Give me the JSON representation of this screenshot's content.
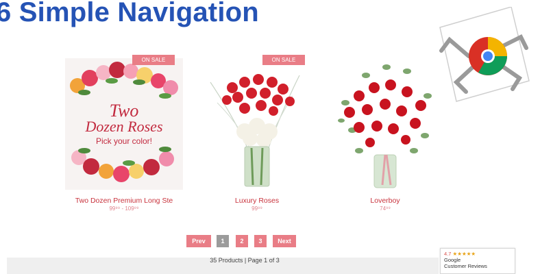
{
  "slide": {
    "title": "6 Simple Navigation"
  },
  "products": [
    {
      "badge": "ON SALE",
      "image_text_line1": "Two",
      "image_text_line2": "Dozen Roses",
      "image_text_line3": "Pick your color!",
      "name": "Two Dozen Premium Long Ste",
      "price": "99⁹⁹ - 109⁹⁹"
    },
    {
      "badge": "ON SALE",
      "name": "Luxury Roses",
      "price": "99⁹⁹"
    },
    {
      "badge": "",
      "name": "Loverboy",
      "price": "74⁹⁹"
    }
  ],
  "pagination": {
    "prev_label": "Prev",
    "pages": [
      "1",
      "2",
      "3"
    ],
    "current_page": "1",
    "next_label": "Next",
    "summary": "35 Products | Page 1 of 3"
  },
  "review_badge": {
    "rating": "4.7",
    "stars": "★★★★★",
    "line1": "Google",
    "line2": "Customer Reviews"
  },
  "colors": {
    "title": "#2553b5",
    "accent": "#e97d86",
    "product_name": "#c8323c",
    "current_page": "#9b9b9b"
  },
  "icons": {
    "robot": "chrome-robot-icon"
  }
}
